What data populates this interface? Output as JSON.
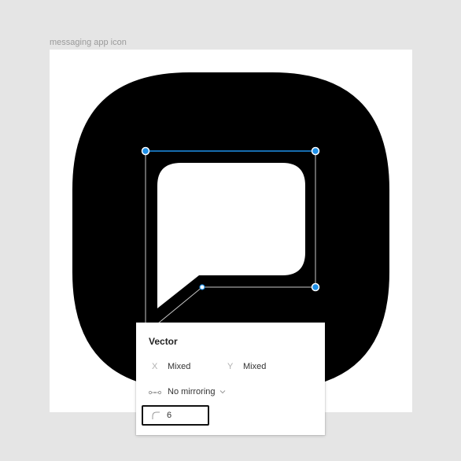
{
  "canvas": {
    "frame_label": "messaging app icon"
  },
  "colors": {
    "canvas_bg": "#e5e5e5",
    "frame_bg": "#ffffff",
    "icon_fill": "#000000",
    "bubble_fill": "#ffffff",
    "selection_blue": "#1e90e8"
  },
  "icons": {
    "vector_handle": "circle-handle",
    "mirroring": "mirror-dots-icon",
    "dropdown": "chevron-down-icon",
    "corner_radius": "corner-radius-icon"
  },
  "panel": {
    "title": "Vector",
    "x_label": "X",
    "x_value": "Mixed",
    "y_label": "Y",
    "y_value": "Mixed",
    "mirroring_value": "No mirroring",
    "corner_radius_value": "6"
  }
}
